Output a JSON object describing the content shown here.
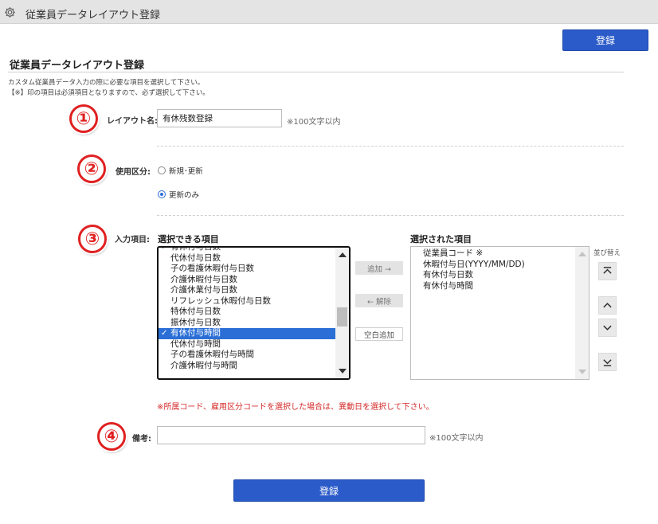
{
  "window": {
    "title": "従業員データレイアウト登録",
    "icon": "gear-icon"
  },
  "header": {
    "register_button": "登録"
  },
  "page": {
    "heading": "従業員データレイアウト登録",
    "desc_line1": "カスタム従業員データ入力の際に必要な項目を選択して下さい。",
    "desc_line2": "【※】印の項目は必須項目となりますので、必ず選択して下さい。"
  },
  "annotations": {
    "n1": "①",
    "n2": "②",
    "n3": "③",
    "n4": "④",
    "color": "#e02020"
  },
  "layout_name": {
    "label": "レイアウト名:",
    "value": "有休残数登録",
    "note": "※100文字以内"
  },
  "usage": {
    "label": "使用区分:",
    "options": [
      {
        "label": "新規･更新",
        "checked": false
      },
      {
        "label": "更新のみ",
        "checked": true
      }
    ]
  },
  "input_items": {
    "label": "入力項目:",
    "available_header": "選択できる項目",
    "selected_header": "選択された項目",
    "available": [
      {
        "label": "有休付与日数",
        "checked": true,
        "selected": false
      },
      {
        "label": "代休付与日数",
        "checked": false,
        "selected": false
      },
      {
        "label": "子の看護休暇付与日数",
        "checked": false,
        "selected": false
      },
      {
        "label": "介護休暇付与日数",
        "checked": false,
        "selected": false
      },
      {
        "label": "介護休業付与日数",
        "checked": false,
        "selected": false
      },
      {
        "label": "リフレッシュ休暇付与日数",
        "checked": false,
        "selected": false
      },
      {
        "label": "特休付与日数",
        "checked": false,
        "selected": false
      },
      {
        "label": "振休付与日数",
        "checked": false,
        "selected": false
      },
      {
        "label": "有休付与時間",
        "checked": true,
        "selected": true
      },
      {
        "label": "代休付与時間",
        "checked": false,
        "selected": false
      },
      {
        "label": "子の看護休暇付与時間",
        "checked": false,
        "selected": false
      },
      {
        "label": "介護休暇付与時間",
        "checked": false,
        "selected": false
      }
    ],
    "selected": [
      "従業員コード ※",
      "休暇付与日(YYYY/MM/DD)",
      "有休付与日数",
      "有休付与時間"
    ],
    "add_button": "追加 →",
    "remove_button": "← 解除",
    "blank_button": "空白追加",
    "sort_label": "並び替え",
    "sort_buttons": [
      "move-top-icon",
      "move-up-icon",
      "move-down-icon",
      "move-bottom-icon"
    ],
    "available_scroll_fraction": 0.55
  },
  "warning": "※所属コード、雇用区分コードを選択した場合は、異動日を選択して下さい。",
  "remarks": {
    "label": "備考:",
    "value": "",
    "note": "※100文字以内"
  },
  "footer": {
    "register_button": "登録"
  }
}
